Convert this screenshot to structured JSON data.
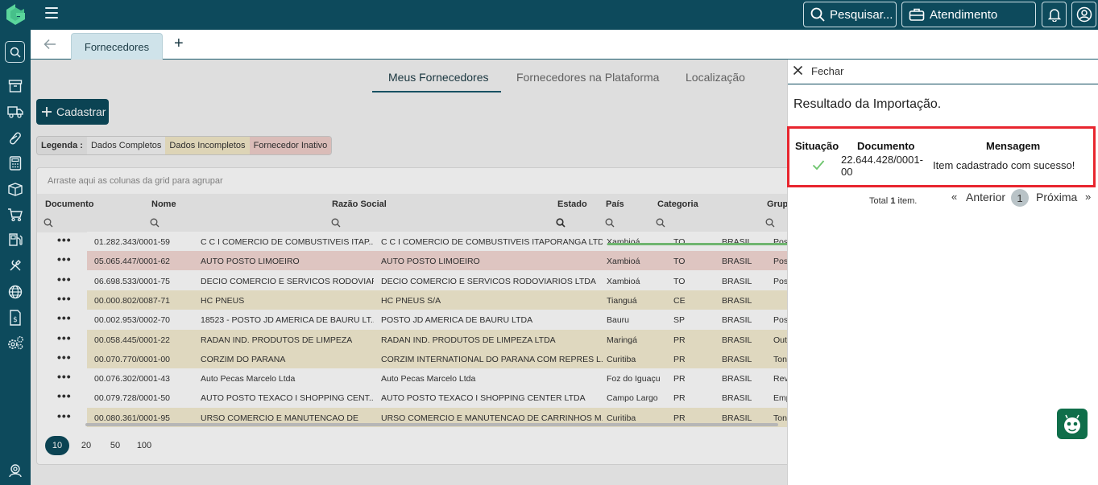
{
  "topbar": {
    "search_label": "Pesquisar...",
    "service_label": "Atendimento",
    "colors": {
      "bar": "#0d4a5c"
    }
  },
  "tabs": {
    "items": [
      {
        "label": "Fornecedores"
      }
    ],
    "add_label": "+"
  },
  "main": {
    "subtabs": [
      {
        "label": "Meus Fornecedores",
        "active": true
      },
      {
        "label": "Fornecedores na Plataforma",
        "active": false
      },
      {
        "label": "Localização",
        "active": false
      }
    ],
    "add_button_label": "Cadastrar",
    "legend": {
      "label": "Legenda :",
      "items": [
        "Dados Completos",
        "Dados Incompletos",
        "Fornecedor Inativo"
      ]
    },
    "grid": {
      "group_hint": "Arraste aqui as colunas da grid para agrupar",
      "columns": [
        "Documento",
        "Nome",
        "Razão Social",
        "Estado",
        "País",
        "Categoria",
        "Grupo"
      ],
      "rows": [
        {
          "status": "full",
          "doc": "01.282.343/0001-59",
          "nome": "C C I COMERCIO DE COMBUSTIVEIS ITAP...",
          "razao": "C C I COMERCIO DE COMBUSTIVEIS ITAPORANGA LTDA",
          "cidade": "Xambioá",
          "uf": "TO",
          "pais": "BRASIL",
          "grupo": "Pos"
        },
        {
          "status": "inact",
          "doc": "05.065.447/0001-62",
          "nome": "AUTO POSTO LIMOEIRO",
          "razao": "AUTO POSTO LIMOEIRO",
          "cidade": "Xambioá",
          "uf": "TO",
          "pais": "BRASIL",
          "grupo": "Pos"
        },
        {
          "status": "full",
          "doc": "06.698.533/0001-75",
          "nome": "DECIO COMERCIO E SERVICOS RODOVIAR...",
          "razao": "DECIO COMERCIO E SERVICOS RODOVIARIOS LTDA",
          "cidade": "Xambioá",
          "uf": "TO",
          "pais": "BRASIL",
          "grupo": "Pos"
        },
        {
          "status": "inc",
          "doc": "00.000.802/0087-71",
          "nome": "HC PNEUS",
          "razao": "HC PNEUS S/A",
          "cidade": "Tianguá",
          "uf": "CE",
          "pais": "BRASIL",
          "grupo": ""
        },
        {
          "status": "full",
          "doc": "00.002.953/0002-70",
          "nome": "18523 - POSTO JD AMERICA DE BAURU LT...",
          "razao": "POSTO JD AMERICA DE BAURU LTDA",
          "cidade": "Bauru",
          "uf": "SP",
          "pais": "BRASIL",
          "grupo": "Pos"
        },
        {
          "status": "inc",
          "doc": "00.058.445/0001-22",
          "nome": "RADAN IND. PRODUTOS DE LIMPEZA",
          "razao": "RADAN IND. PRODUTOS DE LIMPEZA LTDA",
          "cidade": "Maringá",
          "uf": "PR",
          "pais": "BRASIL",
          "grupo": "Out"
        },
        {
          "status": "inc",
          "doc": "00.070.770/0001-00",
          "nome": "CORZIM DO PARANA",
          "razao": "CORZIM INTERNATIONAL DO PARANA COM REPRES L...",
          "cidade": "Curitiba",
          "uf": "PR",
          "pais": "BRASIL",
          "grupo": "Ton"
        },
        {
          "status": "full",
          "doc": "00.076.302/0001-43",
          "nome": "Auto Pecas Marcelo Ltda",
          "razao": "Auto Pecas Marcelo Ltda",
          "cidade": "Foz do Iguaçu",
          "uf": "PR",
          "pais": "BRASIL",
          "grupo": "Rev"
        },
        {
          "status": "full",
          "doc": "00.079.728/0001-50",
          "nome": "AUTO POSTO TEXACO I SHOPPING CENT...",
          "razao": "AUTO POSTO TEXACO I SHOPPING CENTER LTDA",
          "cidade": "Campo Largo",
          "uf": "PR",
          "pais": "BRASIL",
          "grupo": "Emp"
        },
        {
          "status": "inc",
          "doc": "00.080.361/0001-95",
          "nome": "URSO COMERCIO E MANUTENCAO DE",
          "razao": "URSO COMERCIO E MANUTENCAO DE CARRINHOS M...",
          "cidade": "Curitiba",
          "uf": "PR",
          "pais": "BRASIL",
          "grupo": "Ton"
        }
      ],
      "page_sizes": [
        "10",
        "20",
        "50",
        "100"
      ],
      "page_size_selected": "10"
    }
  },
  "panel": {
    "close_label": "Fechar",
    "title": "Resultado da Importação.",
    "headers": {
      "status": "Situação",
      "document": "Documento",
      "message": "Mensagem"
    },
    "result": {
      "document": "22.644.428/0001-00",
      "message": "Item cadastrado com sucesso!"
    },
    "footer": {
      "total_prefix": "Total",
      "total_count": "1",
      "total_suffix": "item.",
      "prev_label": "Anterior",
      "next_label": "Próxima",
      "current_page": "1"
    }
  }
}
